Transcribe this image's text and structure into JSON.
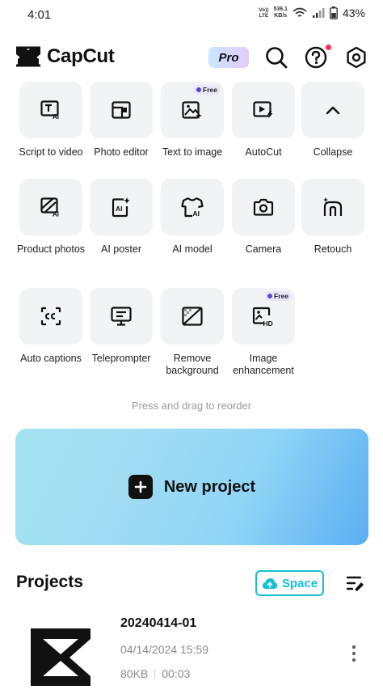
{
  "status_bar": {
    "time": "4:01",
    "volte": "Vo))\nLTE",
    "net_speed_value": "536.1",
    "net_speed_unit": "KB/s",
    "battery": "43%"
  },
  "header": {
    "app_name": "CapCut",
    "pro_label": "Pro",
    "icons": [
      "search-icon",
      "help-icon",
      "settings-icon"
    ]
  },
  "tools": [
    {
      "label": "Script to video",
      "icon": "script-ai-icon",
      "free": false
    },
    {
      "label": "Photo editor",
      "icon": "photo-editor-icon",
      "free": false
    },
    {
      "label": "Text to image",
      "icon": "text-to-image-icon",
      "free": true
    },
    {
      "label": "AutoCut",
      "icon": "autocut-icon",
      "free": false
    },
    {
      "label": "Collapse",
      "icon": "chevron-up-icon",
      "free": false
    },
    {
      "label": "Product photos",
      "icon": "product-photos-icon",
      "free": false
    },
    {
      "label": "AI poster",
      "icon": "ai-poster-icon",
      "free": false
    },
    {
      "label": "AI model",
      "icon": "ai-model-icon",
      "free": false
    },
    {
      "label": "Camera",
      "icon": "camera-icon",
      "free": false
    },
    {
      "label": "Retouch",
      "icon": "retouch-icon",
      "free": false
    },
    {
      "label": "Auto captions",
      "icon": "auto-captions-icon",
      "free": false
    },
    {
      "label": "Teleprompter",
      "icon": "teleprompter-icon",
      "free": false
    },
    {
      "label": "Remove background",
      "icon": "remove-background-icon",
      "free": false
    },
    {
      "label": "Image enhancement",
      "icon": "image-enhancement-icon",
      "free": true
    }
  ],
  "free_badge": "Free",
  "reorder_hint": "Press and drag to reorder",
  "new_project_label": "New project",
  "projects": {
    "title": "Projects",
    "space_label": "Space",
    "items": [
      {
        "name": "20240414-01",
        "date": "04/14/2024 15:59",
        "size": "80KB",
        "duration": "00:03"
      }
    ]
  },
  "colors": {
    "accent_cyan": "#13bfd4",
    "notification_red": "#ff2d55",
    "tile_bg": "#f2f3f5"
  }
}
